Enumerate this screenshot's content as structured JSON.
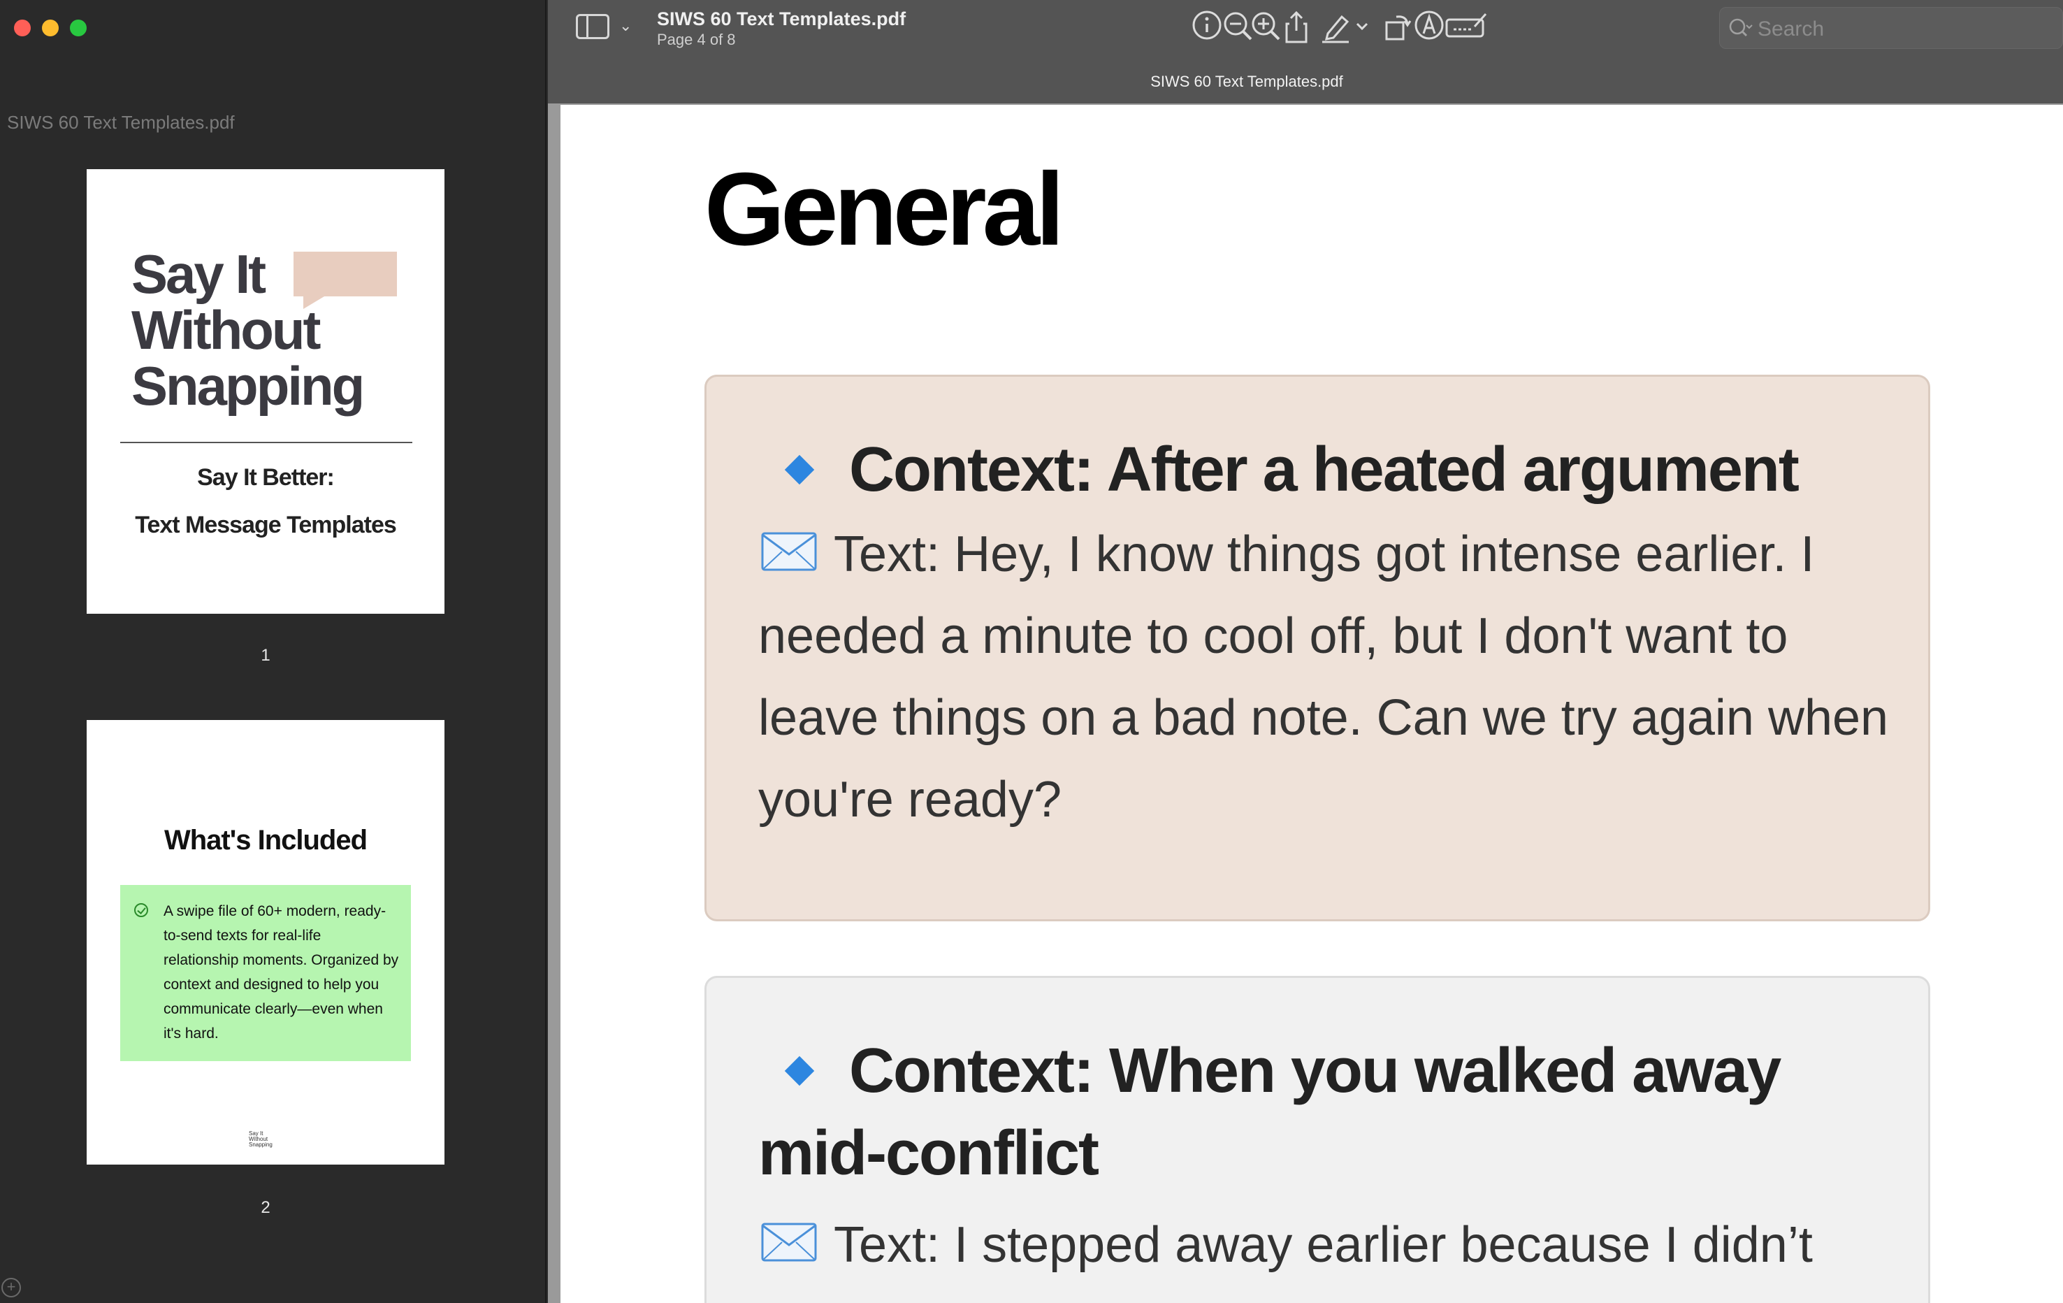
{
  "window": {
    "title": "SIWS 60 Text Templates.pdf",
    "page_indicator": "Page 4 of 8",
    "tab_title": "SIWS 60 Text Templates.pdf"
  },
  "sidebar": {
    "file_title": "SIWS 60 Text Templates.pdf",
    "thumbnails": [
      {
        "number": "1",
        "cover_lines": [
          "Say It",
          "Without",
          "Snapping"
        ],
        "subtitle1": "Say It Better:",
        "subtitle2": "Text Message Templates",
        "accent": "#e8cdbf"
      },
      {
        "number": "2",
        "title": "What's Included",
        "box_text": "A swipe file of 60+ modern, ready-to-send texts for real-life relationship moments. Organized by context and designed to help you communicate clearly—even when it's hard.",
        "box_color": "#b6f5b0",
        "logo_lines": [
          "Say It",
          "Without",
          "Snapping"
        ]
      }
    ]
  },
  "toolbar": {
    "icons": [
      "sidebar-toggle-icon",
      "info-icon",
      "zoom-out-icon",
      "zoom-in-icon",
      "share-icon",
      "highlight-icon",
      "rotate-icon",
      "markup-icon",
      "sign-icon",
      "search-icon"
    ],
    "search_placeholder": "Search"
  },
  "document": {
    "heading": "General",
    "cards": [
      {
        "heading": "Context: After a heated argument",
        "text_prefix": "Text:",
        "text": "Hey, I know things got intense earlier. I needed a minute to cool off, but I don't want to leave things on a bad note. Can we try again when you're ready?",
        "background": "#efe2d9"
      },
      {
        "heading": "Context: When you walked away mid-conflict",
        "text_prefix": "Text:",
        "text": "I stepped away earlier because I didn’t",
        "background": "#f1f1f1"
      }
    ],
    "diamond_color": "#2d86e0"
  }
}
